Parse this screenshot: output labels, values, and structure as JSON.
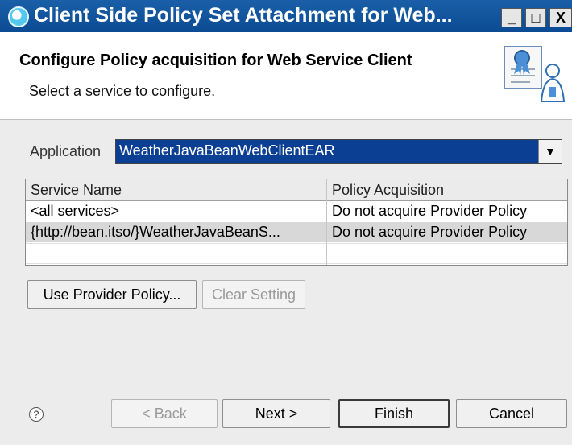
{
  "window": {
    "title": "Client Side Policy Set Attachment for Web...",
    "minimize": "_",
    "maximize": "□",
    "close": "X"
  },
  "banner": {
    "title": "Configure Policy acquisition for Web Service Client",
    "description": "Select a service to configure."
  },
  "application": {
    "label": "Application",
    "selected": "WeatherJavaBeanWebClientEAR"
  },
  "table": {
    "columns": [
      "Service Name",
      "Policy Acquisition"
    ],
    "rows": [
      {
        "service": "<all services>",
        "policy": "Do not acquire Provider Policy"
      },
      {
        "service": "{http://bean.itso/}WeatherJavaBeanS...",
        "policy": "Do not acquire Provider Policy"
      }
    ]
  },
  "actions": {
    "use_provider_policy": "Use Provider Policy...",
    "clear_setting": "Clear Setting"
  },
  "footer": {
    "help": "?",
    "back": "< Back",
    "next": "Next >",
    "finish": "Finish",
    "cancel": "Cancel"
  }
}
